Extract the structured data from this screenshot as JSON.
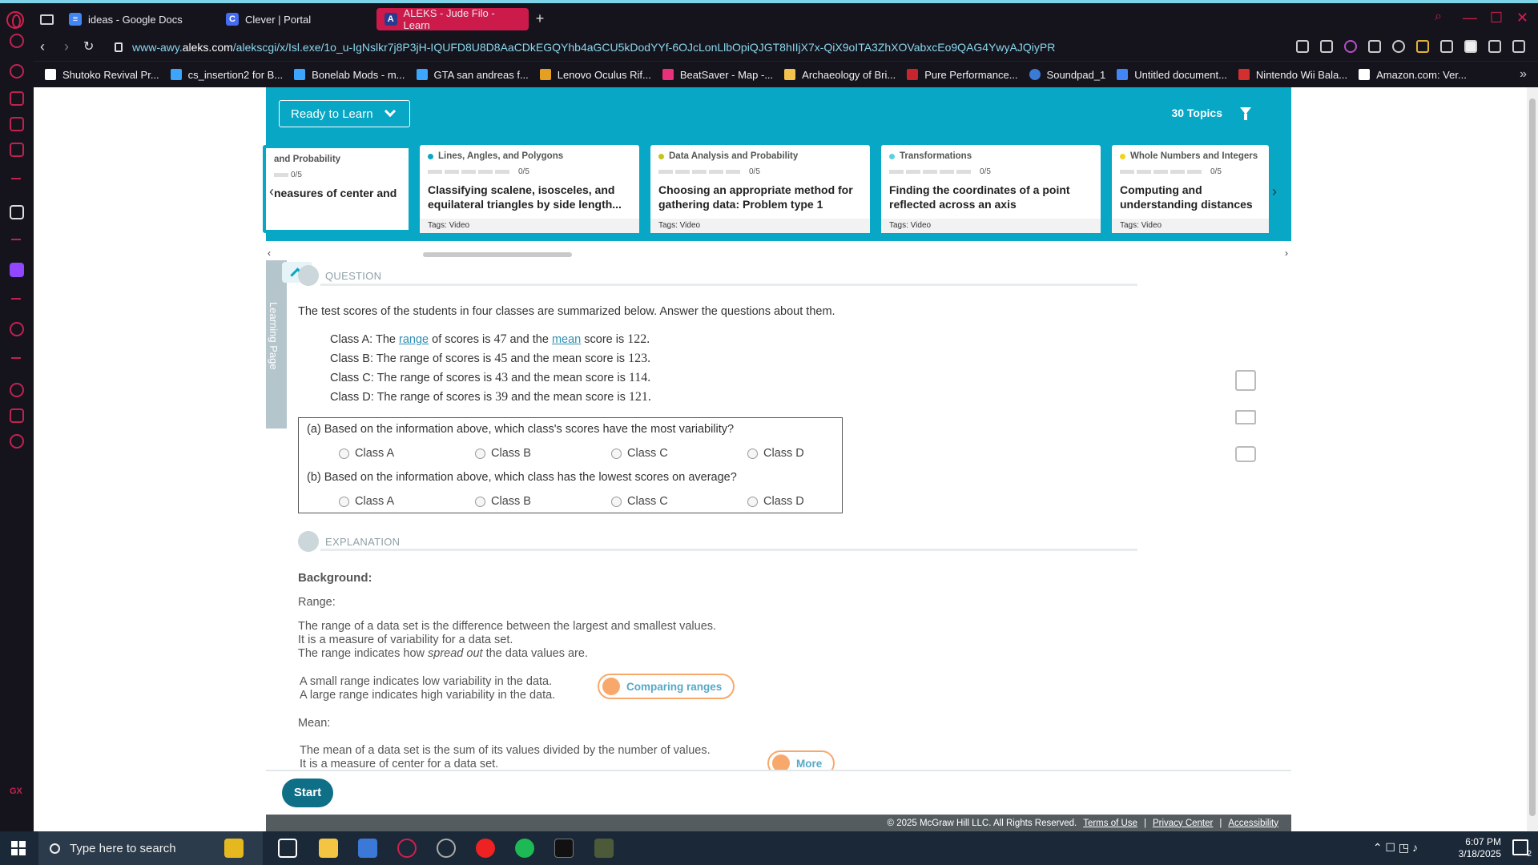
{
  "browser": {
    "tabs": [
      {
        "label": "ideas - Google Docs",
        "icon": "google-docs-icon",
        "color": "#4285f4",
        "glyph": "≡"
      },
      {
        "label": "Clever | Portal",
        "icon": "clever-icon",
        "color": "#436cf2",
        "glyph": "C"
      },
      {
        "label": "ALEKS - Jude Filo - Learn",
        "icon": "aleks-icon",
        "color": "#2a3b8f",
        "glyph": "A"
      }
    ],
    "url_prefix": "www-awy.",
    "url_host": "aleks.com",
    "url_path": "/alekscgi/x/Isl.exe/1o_u-IgNslkr7j8P3jH-IQUFD8U8D8AaCDkEGQYhb4aGCU5kDodYYf-6OJcLonLlbOpiQJGT8hIIjX7x-QiX9oITA3ZhXOVabxcEo9QAG4YwyAJQiyPR",
    "bookmarks": [
      {
        "label": "Shutoko Revival Pr...",
        "color": "#ffffff"
      },
      {
        "label": "cs_insertion2 for B...",
        "color": "#3ca6ff"
      },
      {
        "label": "Bonelab Mods - m...",
        "color": "#3ca6ff"
      },
      {
        "label": "GTA san andreas f...",
        "color": "#3ca6ff"
      },
      {
        "label": "Lenovo Oculus Rif...",
        "color": "#e5a023"
      },
      {
        "label": "BeatSaver - Map -...",
        "color": "#e8317b"
      },
      {
        "label": "Archaeology of Bri...",
        "color": "#f2c14e"
      },
      {
        "label": "Pure Performance...",
        "color": "#c6252e"
      },
      {
        "label": "Soundpad_1",
        "color": "#3a7bd5"
      },
      {
        "label": "Untitled document...",
        "color": "#4285f4"
      },
      {
        "label": "Nintendo Wii Bala...",
        "color": "#d32f2f"
      },
      {
        "label": "Amazon.com: Ver...",
        "color": "#ffffff"
      }
    ]
  },
  "aleks": {
    "ready_label": "Ready to Learn",
    "topics_count": "30 Topics",
    "cards": [
      {
        "category": "and Probability",
        "progress": "0/5",
        "title": "neasures of center and",
        "tags": "",
        "dot": "#e8c619"
      },
      {
        "category": "Lines, Angles, and Polygons",
        "progress": "0/5",
        "title": "Classifying scalene, isosceles, and equilateral triangles by side length...",
        "tags": "Tags: Video",
        "dot": "#07a7c5"
      },
      {
        "category": "Data Analysis and Probability",
        "progress": "0/5",
        "title": "Choosing an appropriate method for gathering data: Problem type 1",
        "tags": "Tags: Video",
        "dot": "#c4c41a"
      },
      {
        "category": "Transformations",
        "progress": "0/5",
        "title": "Finding the coordinates of a point reflected across an axis",
        "tags": "Tags: Video",
        "dot": "#5ad1e3"
      },
      {
        "category": "Whole Numbers and Integers",
        "progress": "0/5",
        "title": "Computing and understanding distances between integers",
        "tags": "Tags: Video",
        "dot": "#f2d21b"
      }
    ],
    "learning_page_label": "Learning Page",
    "question_header": "QUESTION",
    "question_intro": "The test scores of the students in four classes are summarized below. Answer the questions about them.",
    "classes": [
      {
        "name": "Class A:",
        "range": "47",
        "mean": "122"
      },
      {
        "name": "Class B:",
        "range": "45",
        "mean": "123"
      },
      {
        "name": "Class C:",
        "range": "43",
        "mean": "114"
      },
      {
        "name": "Class D:",
        "range": "39",
        "mean": "121"
      }
    ],
    "text_the": "The",
    "text_range_link": "range",
    "text_range": "range",
    "text_of_scores_is": "of scores is",
    "text_and_the": "and the",
    "text_mean_link": "mean",
    "text_mean": "mean",
    "text_score_is": "score is",
    "question_a": "(a) Based on the information above, which class's scores have the most variability?",
    "question_b": "(b) Based on the information above, which class has the lowest scores on average?",
    "options": [
      "Class A",
      "Class B",
      "Class C",
      "Class D"
    ],
    "explanation_header": "EXPLANATION",
    "background_label": "Background:",
    "range_label": "Range:",
    "range_line1": "The range of a data set is the difference between the largest and smallest values.",
    "range_line2": "It is a measure of variability for a data set.",
    "range_line3_a": "The range indicates how",
    "range_line3_em": "spread out",
    "range_line3_b": "the data values are.",
    "small_range": "A small range indicates low variability in the data.",
    "large_range": "A large range indicates high variability in the data.",
    "comparing_ranges": "Comparing ranges",
    "mean_label": "Mean:",
    "mean_line1": "The mean of a data set is the sum of its values divided by the number of values.",
    "mean_line2": "It is a measure of center for a data set.",
    "more_label": "More",
    "start_label": "Start",
    "footer_copyright": "© 2025 McGraw Hill LLC. All Rights Reserved.",
    "footer_terms": "Terms of Use",
    "footer_privacy": "Privacy Center",
    "footer_accessibility": "Accessibility",
    "footer_sep": "|"
  },
  "taskbar": {
    "search_placeholder": "Type here to search",
    "time": "6:07 PM",
    "date": "3/18/2025",
    "notifications": "2"
  }
}
